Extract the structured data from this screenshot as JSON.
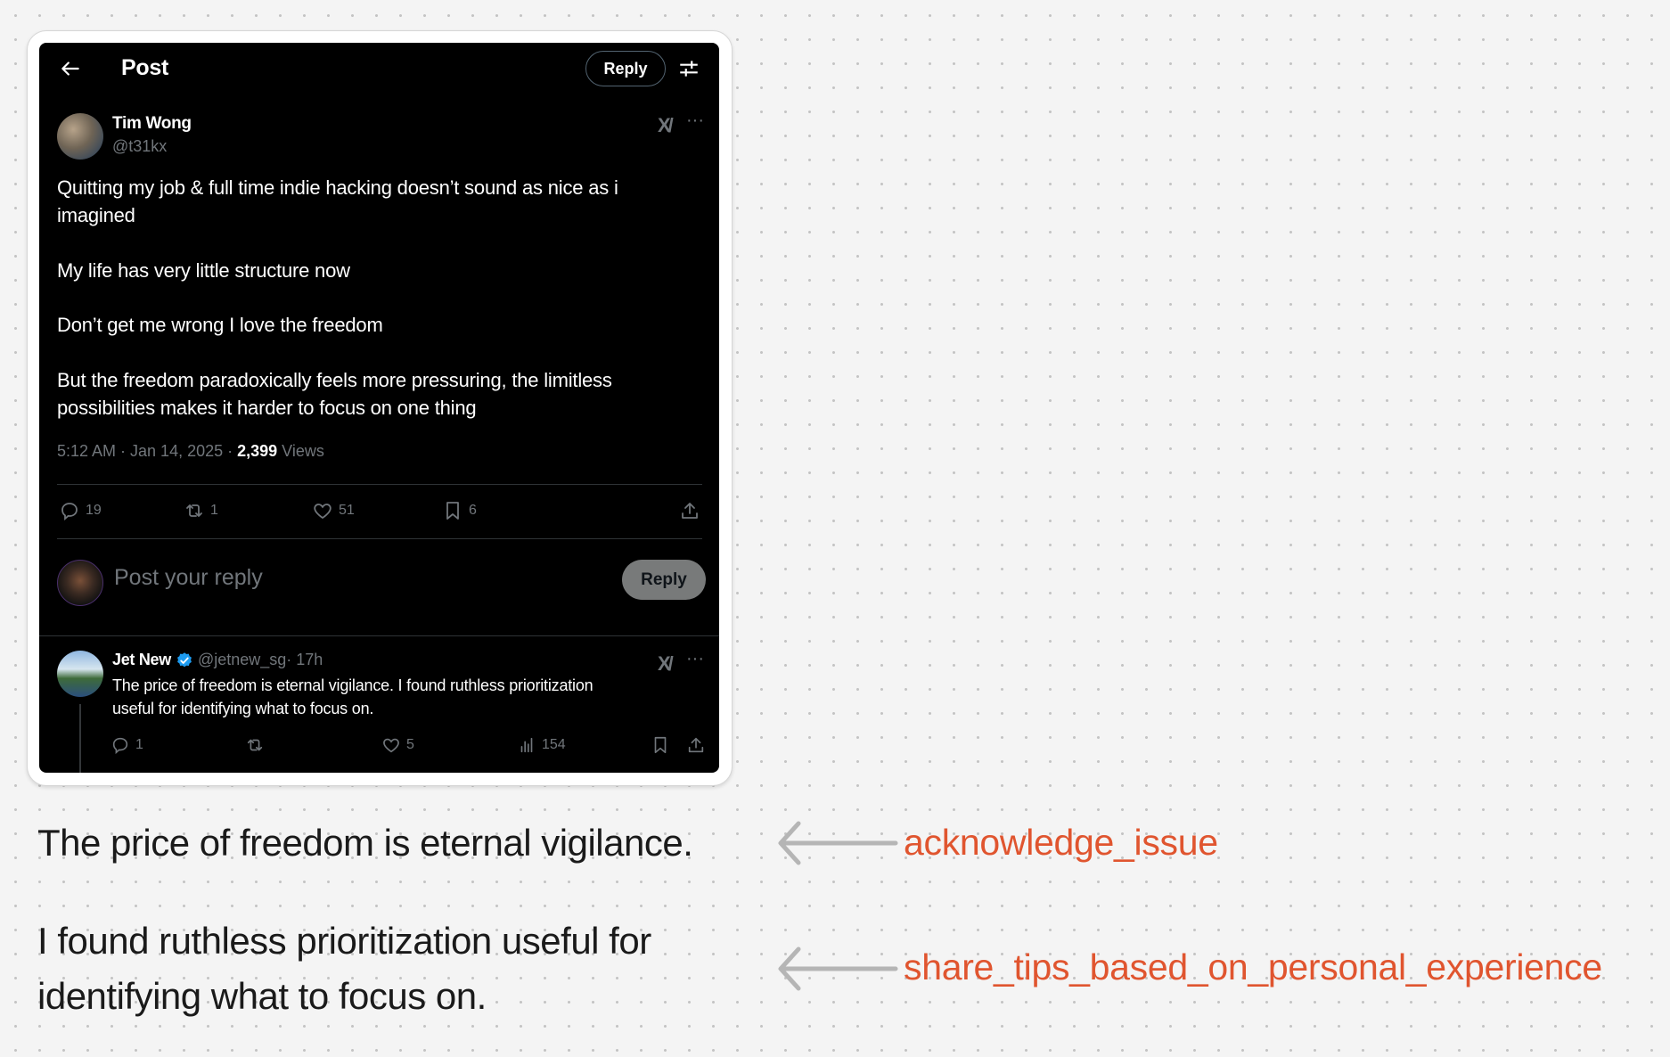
{
  "header": {
    "title": "Post",
    "reply_button": "Reply"
  },
  "main_post": {
    "author_name": "Tim Wong",
    "author_handle": "@t31kx",
    "body_lines": [
      "Quitting my job & full time indie hacking doesn’t sound as nice as i",
      "imagined",
      "My life has very little structure now",
      "Don’t get me wrong I love the freedom",
      "But the freedom paradoxically feels more pressuring, the limitless",
      "possibilities makes it harder to focus on one thing"
    ],
    "timestamp": "5:12 AM · Jan 14, 2025 · ",
    "views_count": "2,399",
    "views_label": " Views",
    "actions": {
      "replies": "19",
      "reposts": "1",
      "likes": "51",
      "bookmarks": "6"
    }
  },
  "composer": {
    "placeholder": "Post your reply",
    "reply_button": "Reply"
  },
  "reply_post": {
    "author_name": "Jet New",
    "author_handle": "@jetnew_sg",
    "time": " · 17h",
    "body_line1": "The price of freedom is eternal vigilance. I found ruthless prioritization",
    "body_line2": "useful for identifying what to focus on.",
    "actions": {
      "replies": "1",
      "reposts": "",
      "likes": "5",
      "views": "154"
    }
  },
  "annotations": [
    {
      "text_lines": [
        "The price of freedom is eternal vigilance."
      ],
      "label": "acknowledge_issue"
    },
    {
      "text_lines": [
        "I found ruthless prioritization useful for",
        "identifying what to focus on."
      ],
      "label": "share_tips_based_on_personal_experience"
    }
  ],
  "colors": {
    "label": "#e0552f",
    "arrow": "#b5b5b5",
    "verified": "#1d9bf0"
  }
}
